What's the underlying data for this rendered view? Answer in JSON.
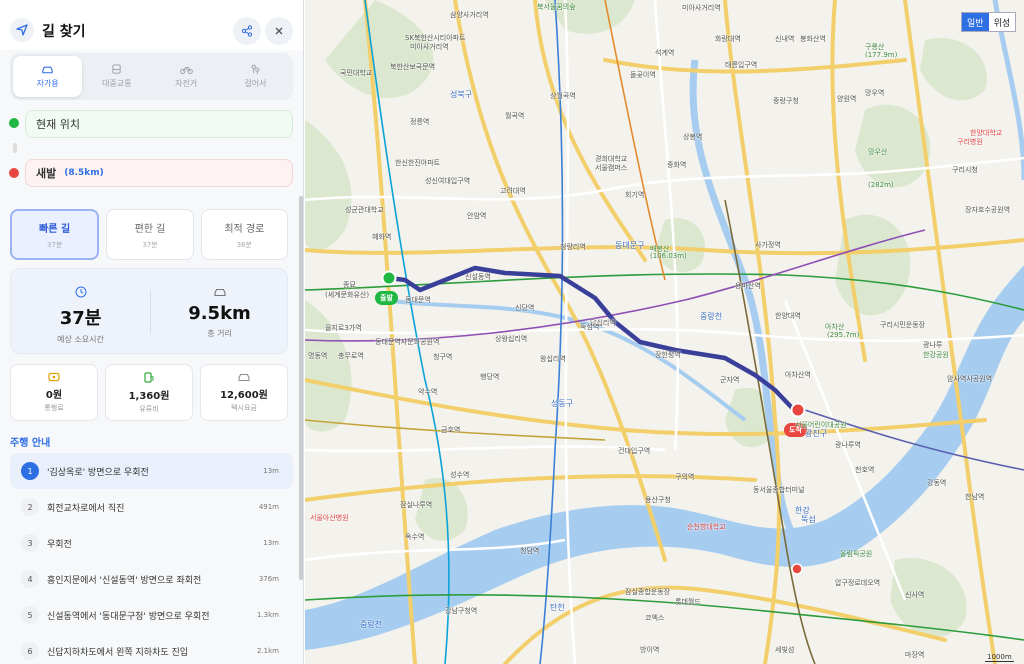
{
  "header": {
    "title": "길 찾기",
    "nav_icon": "navigation-icon",
    "share_icon": "share-icon",
    "close_icon": "close-icon"
  },
  "modes": [
    {
      "label": "자가용",
      "icon": "car-icon",
      "active": true
    },
    {
      "label": "대중교통",
      "icon": "bus-icon",
      "active": false
    },
    {
      "label": "자전거",
      "icon": "bicycle-icon",
      "active": false
    },
    {
      "label": "걸어서",
      "icon": "walk-icon",
      "active": false
    }
  ],
  "origin": {
    "label": "현재 위치",
    "color": "#1fb842"
  },
  "destination": {
    "label": "새발",
    "distance": "(8.5km)",
    "color": "#e8463f"
  },
  "route_options": [
    {
      "name": "빠른 길",
      "time": "37분",
      "active": true
    },
    {
      "name": "편한 길",
      "time": "37분",
      "active": false
    },
    {
      "name": "최적 경로",
      "time": "36분",
      "active": false
    }
  ],
  "summary": {
    "time": "37분",
    "time_label": "예상 소요시간",
    "time_icon": "clock-icon",
    "distance": "9.5km",
    "distance_label": "총 거리",
    "distance_icon": "car-icon"
  },
  "fees": [
    {
      "value": "0원",
      "label": "통행료",
      "icon": "toll-icon",
      "color": "#e0a100"
    },
    {
      "value": "1,360원",
      "label": "유류비",
      "icon": "fuel-icon",
      "color": "#2eaa3c"
    },
    {
      "value": "12,600원",
      "label": "택시요금",
      "icon": "taxi-icon",
      "color": "#8a8f97"
    }
  ],
  "guide_title": "주행 안내",
  "steps": [
    {
      "num": "1",
      "text": "'김상옥로' 방면으로 우회전",
      "dist": "13m",
      "active": true
    },
    {
      "num": "2",
      "text": "회전교차로에서 직진",
      "dist": "491m",
      "active": false
    },
    {
      "num": "3",
      "text": "우회전",
      "dist": "13m",
      "active": false
    },
    {
      "num": "4",
      "text": "흥인지문에서 '신설동역' 방면으로 좌회전",
      "dist": "376m",
      "active": false
    },
    {
      "num": "5",
      "text": "신설동역에서 '동대문구청' 방면으로 우회전",
      "dist": "1.3km",
      "active": false
    },
    {
      "num": "6",
      "text": "신답지하차도에서 왼쪽 지하차도 진입",
      "dist": "2.1km",
      "active": false
    }
  ],
  "map": {
    "type_normal": "일반",
    "type_satellite": "위성",
    "start_tag": "출발",
    "end_tag": "도착",
    "route_color": "#3a3f9a",
    "scale": "1000m",
    "labels": [
      "삼양사거리역",
      "북서울꿈의숲",
      "미아사거리역",
      "SK북한산시티아파트",
      "미아사거리역",
      "북한산보국문역",
      "국민대학교",
      "성북구",
      "돌곶이역",
      "석계역",
      "화랑대역",
      "신내역",
      "구룡산",
      "(177.9m)",
      "망우역",
      "정릉역",
      "월곡역",
      "상월곡역",
      "태릉입구역",
      "봉화산역",
      "양원역",
      "중랑구청",
      "한양대학교",
      "구리병원",
      "한신한진아파트",
      "경희대학교",
      "서울캠퍼스",
      "회기역",
      "중화역",
      "상봉역",
      "망우산",
      "(282m)",
      "구리시청",
      "성신여대입구역",
      "고려대역",
      "성균관대학교",
      "혜화역",
      "안암역",
      "동대문구",
      "청량리역",
      "배봉산",
      "(106.03m)",
      "사가정역",
      "장자호수공원역",
      "종묘",
      "(세계문화유산)",
      "동대문역",
      "신설동역",
      "을지로3가역",
      "동대문역사문화공원역",
      "신당역",
      "상왕십리역",
      "왕십리역",
      "답십리역",
      "장한평역",
      "중랑천",
      "용마산역",
      "아차산",
      "(295.7m)",
      "구리시민운동장",
      "광나루",
      "한강공원",
      "명동역",
      "충무로역",
      "청구역",
      "행당역",
      "군자역",
      "아차산역",
      "암사역사공원역",
      "약수역",
      "금호역",
      "성동구",
      "서울어린이대공원",
      "광진구",
      "광나루역",
      "천호역",
      "강동역",
      "한남역",
      "옥수역",
      "성수역",
      "건대입구역",
      "구의역",
      "동서울종합터미널",
      "한강",
      "뚝섬",
      "용산구청",
      "순천향대학교",
      "서울아산병원",
      "잠실나루역",
      "올림픽공원",
      "압구정로데오역",
      "신사역",
      "청담역",
      "강남구청역",
      "잠실종합운동장",
      "탄천",
      "롯데월드",
      "코엑스",
      "세빛섬",
      "방이역",
      "중랑천",
      "마장역",
      "한양대역",
      "뚝섬역"
    ]
  }
}
